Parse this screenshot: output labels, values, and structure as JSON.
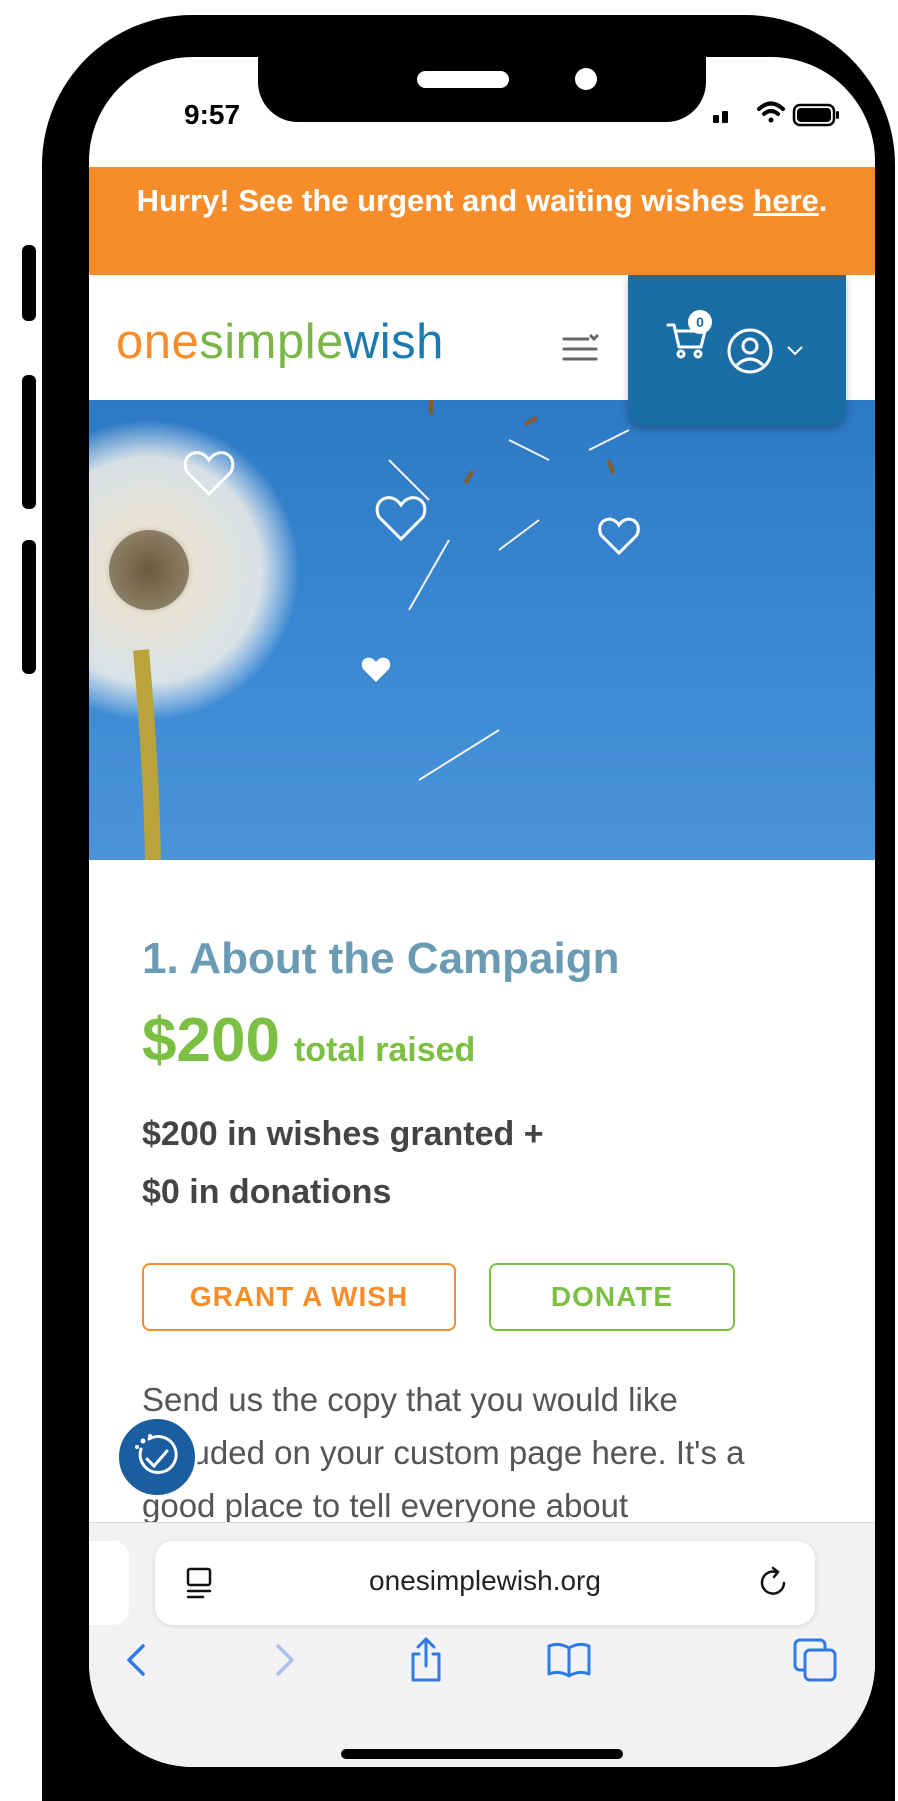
{
  "status_bar": {
    "time": "9:57"
  },
  "banner": {
    "text_before": "Hurry! See the urgent and waiting wishes ",
    "link_text": "here",
    "text_after": "."
  },
  "header": {
    "logo": {
      "part1": "one",
      "part2": "simple",
      "part3": "wish"
    },
    "cart_count": "0"
  },
  "campaign": {
    "title": "1. About the Campaign",
    "total_amount": "$200",
    "total_label": "total raised",
    "wishes_line": "$200 in wishes granted +",
    "donations_line": "$0 in donations",
    "grant_button": "GRANT A WISH",
    "donate_button": "DONATE",
    "body_text": "Send us the copy that you would like included on your custom page here. It's a good place to tell everyone about"
  },
  "browser": {
    "url": "onesimplewish.org"
  },
  "colors": {
    "orange": "#f68d2a",
    "green": "#7bc043",
    "blue": "#1b6ea4",
    "title_blue": "#6b9bb2",
    "ios_blue": "#2f7ae5"
  },
  "icons": [
    "cart-icon",
    "user-icon",
    "chevron-down-icon",
    "hamburger-icon",
    "accessibility-icon",
    "page-icon",
    "reload-icon",
    "back-icon",
    "forward-icon",
    "share-icon",
    "bookmarks-icon",
    "tabs-icon"
  ]
}
